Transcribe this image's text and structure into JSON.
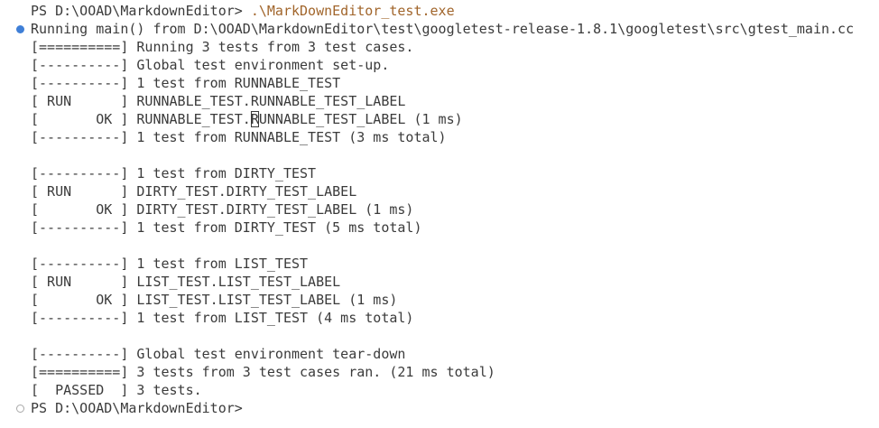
{
  "terminal": {
    "prompt1": "PS D:\\OOAD\\MarkdownEditor> ",
    "command": ".\\MarkDownEditor_test.exe",
    "running": "Running main() from D:\\OOAD\\MarkdownEditor\\test\\googletest-release-1.8.1\\googletest\\src\\gtest_main.cc",
    "lines": [
      "[==========] Running 3 tests from 3 test cases.",
      "[----------] Global test environment set-up.",
      "[----------] 1 test from RUNNABLE_TEST",
      "[ RUN      ] RUNNABLE_TEST.RUNNABLE_TEST_LABEL"
    ],
    "ok_line_prefix": "[       OK ] RUNNABLE_TEST.",
    "ok_line_cursor_char": "R",
    "ok_line_suffix": "UNNABLE_TEST_LABEL (1 ms)",
    "lines2": [
      "[----------] 1 test from RUNNABLE_TEST (3 ms total)",
      "",
      "[----------] 1 test from DIRTY_TEST",
      "[ RUN      ] DIRTY_TEST.DIRTY_TEST_LABEL",
      "[       OK ] DIRTY_TEST.DIRTY_TEST_LABEL (1 ms)",
      "[----------] 1 test from DIRTY_TEST (5 ms total)",
      "",
      "[----------] 1 test from LIST_TEST",
      "[ RUN      ] LIST_TEST.LIST_TEST_LABEL",
      "[       OK ] LIST_TEST.LIST_TEST_LABEL (1 ms)",
      "[----------] 1 test from LIST_TEST (4 ms total)",
      "",
      "[----------] Global test environment tear-down",
      "[==========] 3 tests from 3 test cases ran. (21 ms total)",
      "[  PASSED  ] 3 tests."
    ],
    "prompt2": "PS D:\\OOAD\\MarkdownEditor> "
  },
  "colors": {
    "background": "#ffffff",
    "text": "#3b3b3b",
    "command_arg": "#a1652b",
    "success_dot": "#3f7fd7",
    "idle_dot": "#a8a8a8"
  }
}
